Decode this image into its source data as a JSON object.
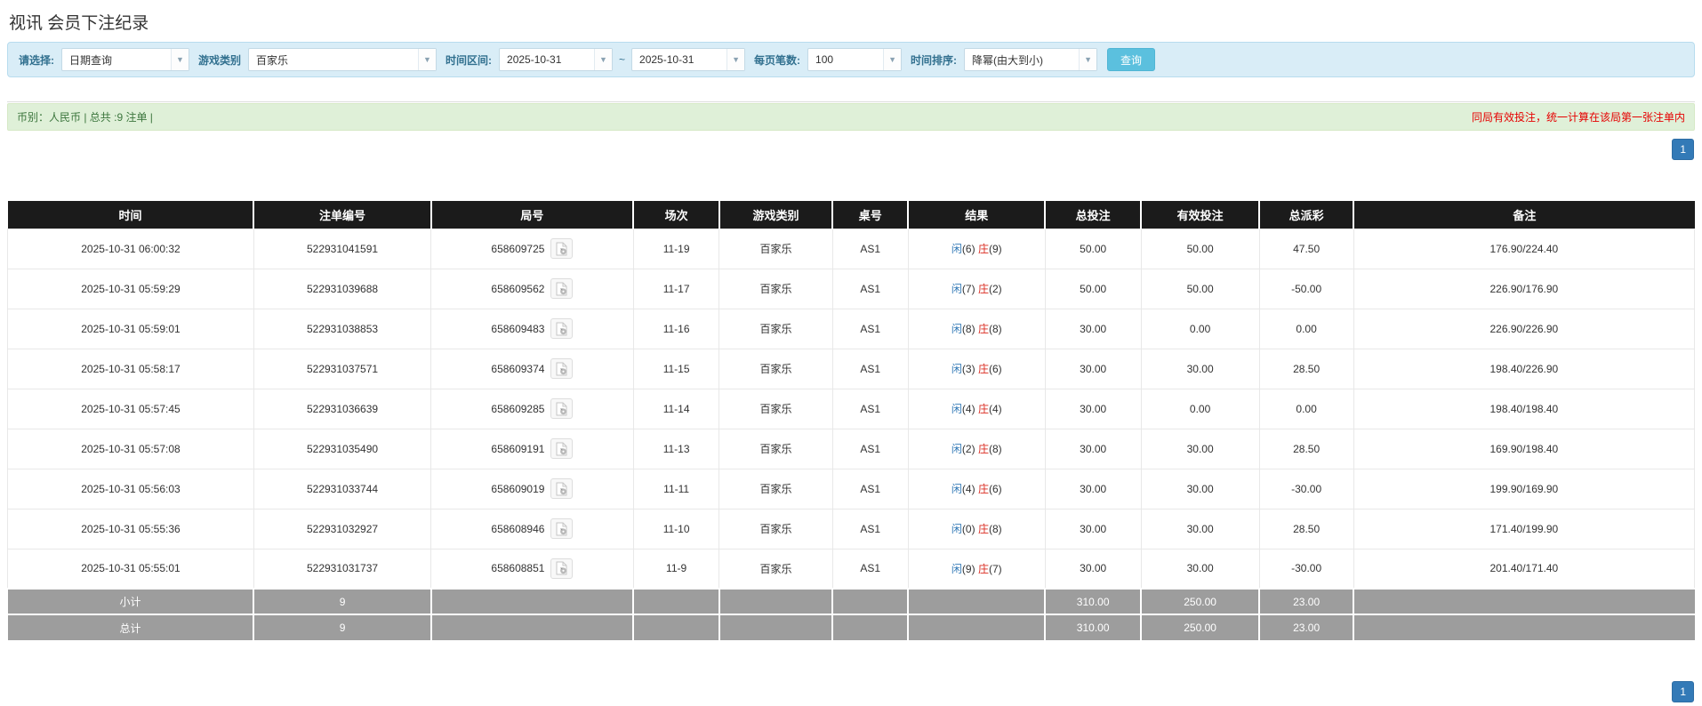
{
  "page": {
    "title": "视讯 会员下注纪录"
  },
  "filters": {
    "select_label": "请选择:",
    "select_value": "日期查询",
    "game_label": "游戏类别",
    "game_value": "百家乐",
    "range_label": "时间区间:",
    "date_from": "2025-10-31",
    "range_separator": "~",
    "date_to": "2025-10-31",
    "page_size_label": "每页笔数:",
    "page_size_value": "100",
    "sort_label": "时间排序:",
    "sort_value": "降幂(由大到小)",
    "search_button": "查询"
  },
  "summary_bar": {
    "currency_info": "币别：人民币 | 总共 :9 注单 |",
    "notice": "同局有效投注，统一计算在该局第一张注单内"
  },
  "pagination": {
    "page_top": "1",
    "page_bottom": "1"
  },
  "colors": {
    "accent_blue": "#337ab7",
    "negative_red": "#e60000",
    "player_blue": "#337ab7",
    "banker_red": "#d9281e",
    "header_bg": "#1b1b1b",
    "summary_row_bg": "#9d9d9d",
    "filter_bg": "#d9edf7",
    "notice_bg": "#dff0d8"
  },
  "table": {
    "headers": [
      "时间",
      "注单编号",
      "局号",
      "场次",
      "游戏类别",
      "桌号",
      "结果",
      "总投注",
      "有效投注",
      "总派彩",
      "备注"
    ],
    "col_widths": [
      "14.6%",
      "10.5%",
      "12%",
      "5.1%",
      "6.7%",
      "4.5%",
      "8.1%",
      "5.7%",
      "7%",
      "5.6%",
      "20.2%"
    ],
    "result_labels": {
      "player": "闲",
      "banker": "庄"
    },
    "video_icon": "video-record-icon",
    "rows": [
      {
        "time": "2025-10-31 06:00:32",
        "bet_no": "522931041591",
        "round_no": "658609725",
        "session": "11-19",
        "game": "百家乐",
        "table_no": "AS1",
        "player": "(6)",
        "banker": "(9)",
        "total_bet": "50.00",
        "valid_bet": "50.00",
        "payout": "47.50",
        "remark": "176.90/224.40"
      },
      {
        "time": "2025-10-31 05:59:29",
        "bet_no": "522931039688",
        "round_no": "658609562",
        "session": "11-17",
        "game": "百家乐",
        "table_no": "AS1",
        "player": "(7)",
        "banker": "(2)",
        "total_bet": "50.00",
        "valid_bet": "50.00",
        "payout": "-50.00",
        "remark": "226.90/176.90"
      },
      {
        "time": "2025-10-31 05:59:01",
        "bet_no": "522931038853",
        "round_no": "658609483",
        "session": "11-16",
        "game": "百家乐",
        "table_no": "AS1",
        "player": "(8)",
        "banker": "(8)",
        "total_bet": "30.00",
        "valid_bet": "0.00",
        "payout": "0.00",
        "remark": "226.90/226.90"
      },
      {
        "time": "2025-10-31 05:58:17",
        "bet_no": "522931037571",
        "round_no": "658609374",
        "session": "11-15",
        "game": "百家乐",
        "table_no": "AS1",
        "player": "(3)",
        "banker": "(6)",
        "total_bet": "30.00",
        "valid_bet": "30.00",
        "payout": "28.50",
        "remark": "198.40/226.90"
      },
      {
        "time": "2025-10-31 05:57:45",
        "bet_no": "522931036639",
        "round_no": "658609285",
        "session": "11-14",
        "game": "百家乐",
        "table_no": "AS1",
        "player": "(4)",
        "banker": "(4)",
        "total_bet": "30.00",
        "valid_bet": "0.00",
        "payout": "0.00",
        "remark": "198.40/198.40"
      },
      {
        "time": "2025-10-31 05:57:08",
        "bet_no": "522931035490",
        "round_no": "658609191",
        "session": "11-13",
        "game": "百家乐",
        "table_no": "AS1",
        "player": "(2)",
        "banker": "(8)",
        "total_bet": "30.00",
        "valid_bet": "30.00",
        "payout": "28.50",
        "remark": "169.90/198.40"
      },
      {
        "time": "2025-10-31 05:56:03",
        "bet_no": "522931033744",
        "round_no": "658609019",
        "session": "11-11",
        "game": "百家乐",
        "table_no": "AS1",
        "player": "(4)",
        "banker": "(6)",
        "total_bet": "30.00",
        "valid_bet": "30.00",
        "payout": "-30.00",
        "remark": "199.90/169.90"
      },
      {
        "time": "2025-10-31 05:55:36",
        "bet_no": "522931032927",
        "round_no": "658608946",
        "session": "11-10",
        "game": "百家乐",
        "table_no": "AS1",
        "player": "(0)",
        "banker": "(8)",
        "total_bet": "30.00",
        "valid_bet": "30.00",
        "payout": "28.50",
        "remark": "171.40/199.90"
      },
      {
        "time": "2025-10-31 05:55:01",
        "bet_no": "522931031737",
        "round_no": "658608851",
        "session": "11-9",
        "game": "百家乐",
        "table_no": "AS1",
        "player": "(9)",
        "banker": "(7)",
        "total_bet": "30.00",
        "valid_bet": "30.00",
        "payout": "-30.00",
        "remark": "201.40/171.40"
      }
    ],
    "subtotal_row": {
      "label": "小计",
      "count": "9",
      "total_bet": "310.00",
      "valid_bet": "250.00",
      "payout": "23.00"
    },
    "total_row": {
      "label": "总计",
      "count": "9",
      "total_bet": "310.00",
      "valid_bet": "250.00",
      "payout": "23.00"
    }
  }
}
